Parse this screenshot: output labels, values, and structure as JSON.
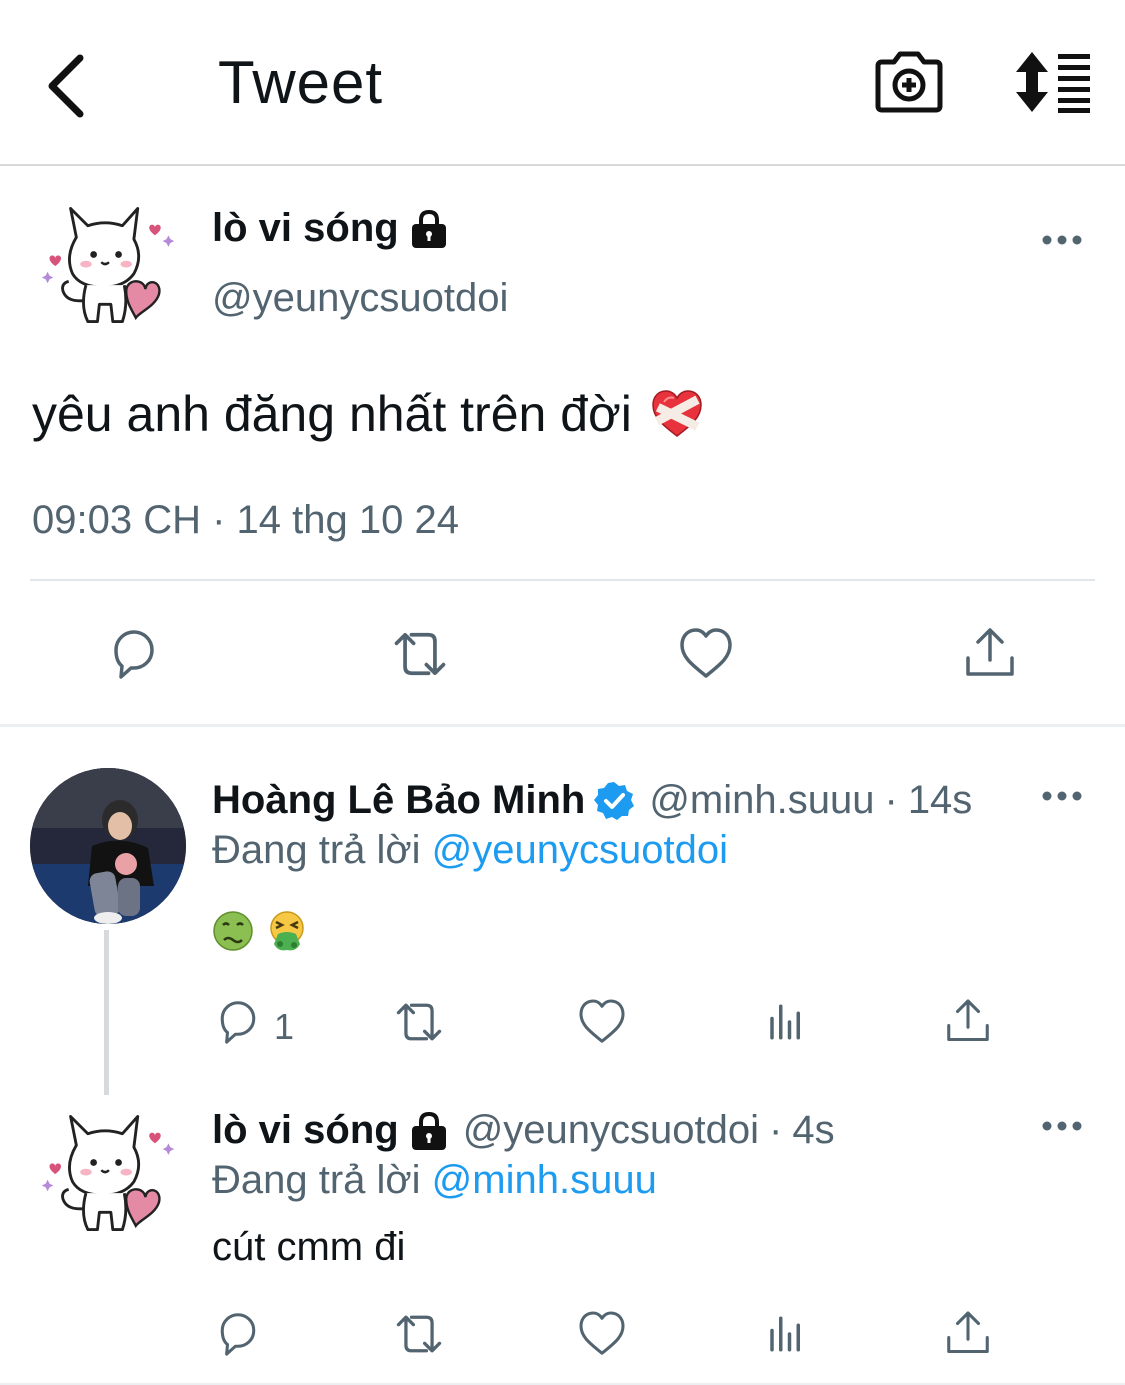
{
  "header": {
    "title": "Tweet",
    "back_icon": "back-chevron-icon",
    "camera_icon": "camera-add-icon",
    "sort_icon": "sort-replies-icon"
  },
  "main_tweet": {
    "display_name": "lò vi sóng",
    "handle": "@yeunycsuotdoi",
    "text": "yêu anh đăng nhất trên đời",
    "emoji": "mending-heart",
    "timestamp": "09:03 CH · 14 thg 10 24",
    "actions": [
      "reply-icon",
      "retweet-icon",
      "like-icon",
      "share-icon"
    ]
  },
  "replies": [
    {
      "display_name": "Hoàng Lê Bảo Minh",
      "verified": true,
      "handle": "@minh.suuu",
      "separator": "·",
      "time": "14s",
      "replying_prefix": "Đang trả lời",
      "replying_to": "@yeunycsuotdoi",
      "emojis": [
        "nauseated-face",
        "vomiting-face"
      ],
      "reply_count": "1"
    },
    {
      "display_name": "lò vi sóng",
      "handle": "@yeunycsuotdoi",
      "separator": "·",
      "time": "4s",
      "replying_prefix": "Đang trả lời",
      "replying_to": "@minh.suuu",
      "text": "cút cmm đi"
    }
  ],
  "colors": {
    "text": "#0f1419",
    "secondary": "#536471",
    "link": "#1d9bf0",
    "verified": "#1d9bf0",
    "divider": "#e1e6ea"
  }
}
